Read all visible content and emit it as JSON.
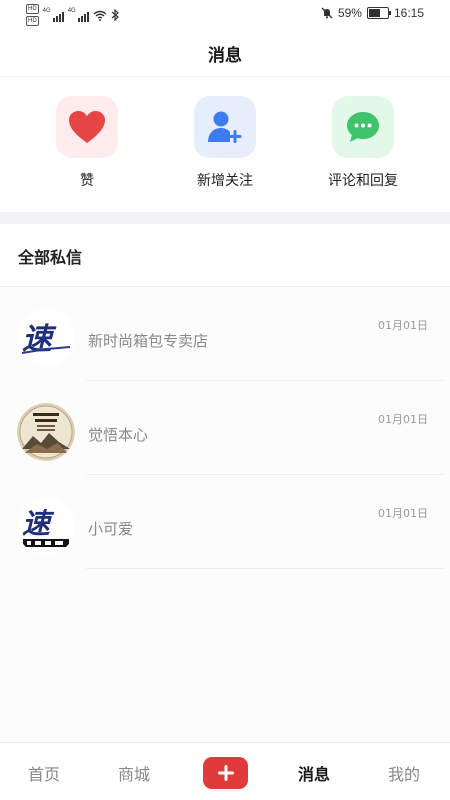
{
  "status_bar": {
    "network_badges": [
      "HD",
      "HD"
    ],
    "signal_labels": [
      "4G",
      "4G"
    ],
    "battery_percent": "59%",
    "battery_level": 0.59,
    "time": "16:15",
    "icons": [
      "signal-icon",
      "wifi-icon",
      "bluetooth-icon",
      "mute-icon",
      "battery-icon"
    ]
  },
  "header": {
    "title": "消息"
  },
  "quick_actions": [
    {
      "label": "赞",
      "icon": "heart-icon",
      "bg": "#fdeceb",
      "color": "#e64545"
    },
    {
      "label": "新增关注",
      "icon": "add-user-icon",
      "bg": "#e6eefc",
      "color": "#3f7bef"
    },
    {
      "label": "评论和回复",
      "icon": "comment-icon",
      "bg": "#e4f8ea",
      "color": "#3fc46c"
    }
  ],
  "messages": {
    "title": "全部私信",
    "items": [
      {
        "name": "新时尚箱包专卖店",
        "time": "01月01日",
        "avatar": "speed-logo"
      },
      {
        "name": "觉悟本心",
        "time": "01月01日",
        "avatar": "calligraphy-seal"
      },
      {
        "name": "小可爱",
        "time": "01月01日",
        "avatar": "speed-logo"
      }
    ]
  },
  "bottom_nav": {
    "items": [
      {
        "label": "首页",
        "active": false
      },
      {
        "label": "商城",
        "active": false
      },
      {
        "label": "消息",
        "active": true
      },
      {
        "label": "我的",
        "active": false
      }
    ],
    "plus_icon": "plus-icon",
    "accent": "#e03a3a"
  }
}
